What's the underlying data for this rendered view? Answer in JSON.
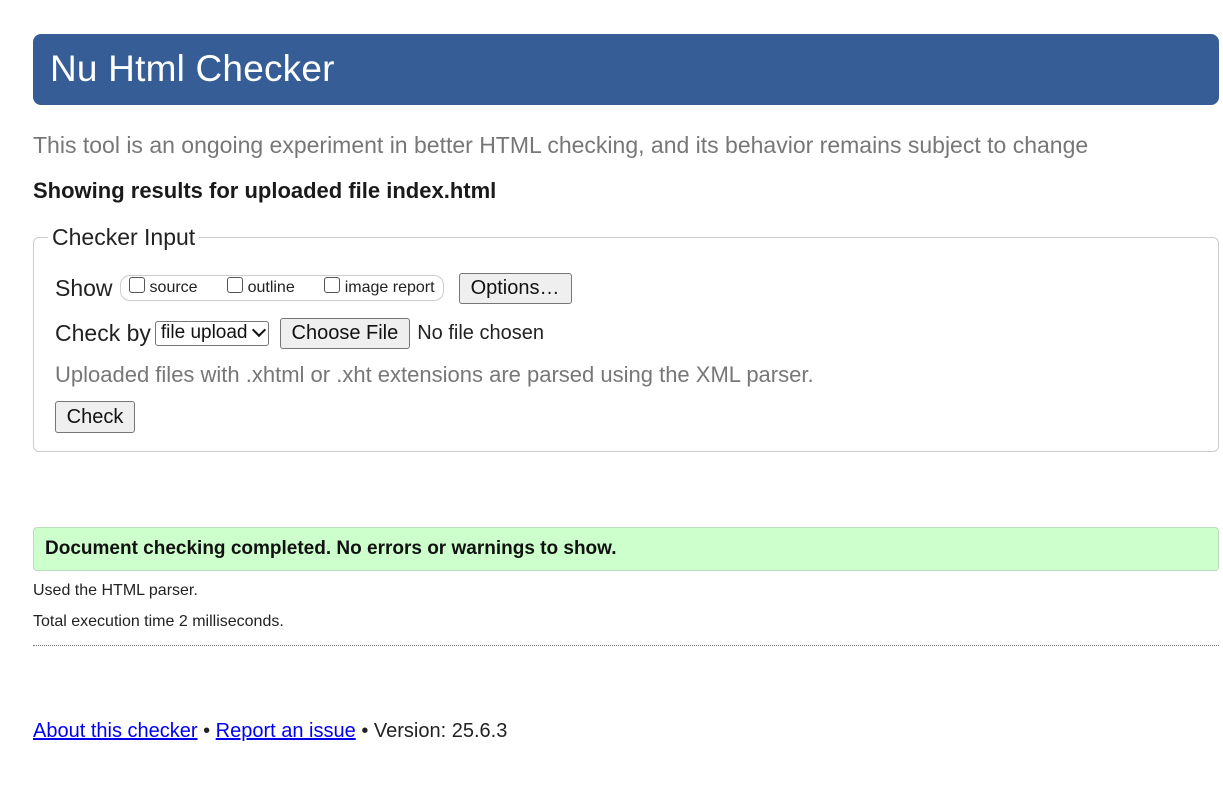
{
  "header": {
    "title": "Nu Html Checker"
  },
  "tagline": "This tool is an ongoing experiment in better HTML checking, and its behavior remains subject to change",
  "results_heading": "Showing results for uploaded file index.html",
  "checker_input": {
    "legend": "Checker Input",
    "show_label": "Show",
    "show_options": [
      {
        "label": "source",
        "checked": false
      },
      {
        "label": "outline",
        "checked": false
      },
      {
        "label": "image report",
        "checked": false
      }
    ],
    "options_button": "Options…",
    "check_by_label": "Check by",
    "check_by_selected": "file upload",
    "choose_file_button": "Choose File",
    "no_file_text": "No file chosen",
    "xml_note": "Uploaded files with .xhtml or .xht extensions are parsed using the XML parser.",
    "check_button": "Check"
  },
  "result": {
    "success_message": "Document checking completed. No errors or warnings to show.",
    "parser_info": "Used the HTML parser.",
    "execution_time": "Total execution time 2 milliseconds."
  },
  "footer": {
    "about_link": "About this checker",
    "separator": "•",
    "report_link": "Report an issue",
    "version_text": "Version: 25.6.3"
  },
  "colors": {
    "header_bg": "#365d95",
    "success_bg": "#ccffcc",
    "link": "#0000ee",
    "muted_text": "#777777"
  }
}
